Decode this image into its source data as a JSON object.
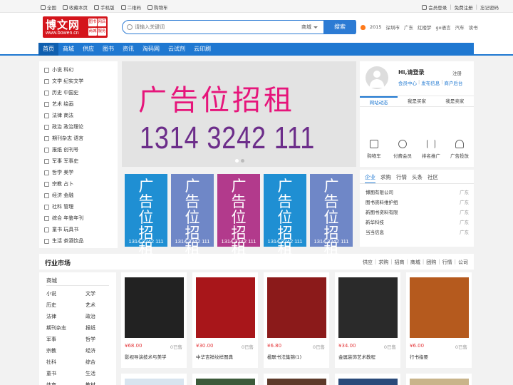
{
  "topbar": {
    "left": [
      "全国",
      "收藏本页",
      "手机版",
      "二维码",
      "购物车"
    ],
    "right": [
      "会员登录",
      "免费注册",
      "忘记密码"
    ]
  },
  "logo": {
    "title": "博文网",
    "url": "www.bowen.cn",
    "badges": [
      "图书",
      "网店",
      "商城",
      "服务"
    ]
  },
  "search": {
    "placeholder": "请输入关键词",
    "scope": "商城",
    "button": "搜索"
  },
  "hot": [
    "2015",
    "深圳市",
    "广东",
    "红楼梦",
    "go语言",
    "汽车",
    "读书"
  ],
  "nav": [
    "首页",
    "商城",
    "供应",
    "图书",
    "资讯",
    "淘码网",
    "云试剂",
    "云印刷"
  ],
  "categories": [
    "小说 科幻",
    "文学 纪实文学",
    "历史 中国史",
    "艺术 绘画",
    "法律 商法",
    "政治 政治理论",
    "期刊杂志 语言",
    "报纸 创刊号",
    "军事 军事史",
    "哲学 美学",
    "宗教 占卜",
    "经济 金融",
    "社科 管理",
    "综合 年鉴年刊",
    "童书 玩具书",
    "生活 茶酒饮品"
  ],
  "banner": {
    "line1": "广告位招租",
    "line2": "1314 3242 111"
  },
  "tiles": [
    {
      "text": "广告位招租",
      "num": "1314 3242 111",
      "color": "#1f8fd3"
    },
    {
      "text": "广告位招租",
      "num": "1314 3242 111",
      "color": "#6f87c7"
    },
    {
      "text": "广告位招租",
      "num": "1314 3242 111",
      "color": "#b23a8c"
    },
    {
      "text": "广告位招租",
      "num": "1314 3242 111",
      "color": "#1f8fd3"
    },
    {
      "text": "广告位招租",
      "num": "1314 3242 111",
      "color": "#6f87c7"
    }
  ],
  "user": {
    "greeting": "Hi,请登录",
    "register": "注册",
    "links": [
      "会员中心",
      "发布信息",
      "商户后台"
    ],
    "tabs": [
      "网站动态",
      "我是买家",
      "我是卖家"
    ],
    "icons": [
      {
        "label": "购物车",
        "icon": "cart-icon"
      },
      {
        "label": "付费会员",
        "icon": "vip-icon"
      },
      {
        "label": "排名推广",
        "icon": "rank-icon"
      },
      {
        "label": "广告投放",
        "icon": "ad-icon"
      }
    ]
  },
  "news": {
    "tabs": [
      "企业",
      "求购",
      "行情",
      "头条",
      "社区"
    ],
    "rows": [
      {
        "name": "博图有限公司",
        "region": "广东"
      },
      {
        "name": "图书资料维护组",
        "region": "广东"
      },
      {
        "name": "新图书资料有限",
        "region": "广东"
      },
      {
        "name": "新华科技",
        "region": "广东"
      },
      {
        "name": "当当信息",
        "region": "广东"
      }
    ]
  },
  "market": {
    "title": "行业市场",
    "filters": [
      "供应",
      "求购",
      "招商",
      "商城",
      "团购",
      "行情",
      "公司"
    ],
    "side_title": "商城",
    "side_cats": [
      [
        "小说",
        "文学"
      ],
      [
        "历史",
        "艺术"
      ],
      [
        "法律",
        "政治"
      ],
      [
        "期刊杂志",
        "报纸"
      ],
      [
        "军事",
        "哲学"
      ],
      [
        "宗教",
        "经济"
      ],
      [
        "社科",
        "综合"
      ],
      [
        "童书",
        "生活"
      ],
      [
        "体育",
        "教材"
      ]
    ],
    "products": [
      {
        "price": "¥68.00",
        "sold": "0已售",
        "name": "影视导演技术与美学",
        "bg": "#222"
      },
      {
        "price": "¥30.00",
        "sold": "0已售",
        "name": "中华吉祥纹样图典",
        "bg": "#a8161a"
      },
      {
        "price": "¥6.80",
        "sold": "0已售",
        "name": "楹联书法集锦(1)",
        "bg": "#8b1a1a"
      },
      {
        "price": "¥34.00",
        "sold": "0已售",
        "name": "金属装饰艺术教程",
        "bg": "#2a2a2a"
      },
      {
        "price": "¥6.00",
        "sold": "0已售",
        "name": "行书指要",
        "bg": "#b55a1e"
      }
    ]
  }
}
